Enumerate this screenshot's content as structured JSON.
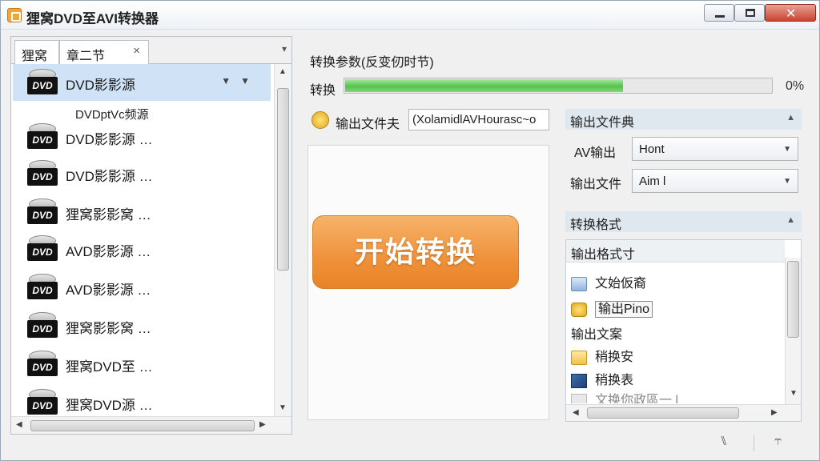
{
  "window": {
    "title": "狸窝DVD至AVI转换器",
    "close_glyph": "✕"
  },
  "tabs": [
    {
      "label": "狸窝"
    },
    {
      "label": "章二节",
      "close": "×"
    }
  ],
  "tab_menu_glyph": "▾",
  "list": {
    "items": [
      {
        "label": "DVD影影源",
        "icon": "DVD",
        "selected": true,
        "arrows": "▼▼"
      },
      {
        "label": "DVD影影源 …",
        "icon": "DVD"
      },
      {
        "label": "DVD影影源 …",
        "icon": "DVD"
      },
      {
        "label": "狸窝影影窝 …",
        "icon": "DVD"
      },
      {
        "label": "AVD影影源 …",
        "icon": "DVD"
      },
      {
        "label": "AVD影影源 …",
        "icon": "DVD"
      },
      {
        "label": "狸窝影影窝 …",
        "icon": "DVD"
      },
      {
        "label": "狸窝DVD至 …",
        "icon": "DVD"
      },
      {
        "label": "狸窝DVD源 …",
        "icon": "DVD"
      }
    ],
    "sub_item": "DVDptVc频源"
  },
  "conversion": {
    "params_label": "转换参数(反变仞时节)",
    "progress_label": "转换",
    "progress_fraction": 0.65,
    "progress_value": "0%"
  },
  "output": {
    "folder_label": "输出文件夫",
    "path_value": "(XolamidlAVHourasc~o"
  },
  "start_button": "开始转换",
  "right": {
    "section1_title": "输出文件典",
    "av_label": "AV输出",
    "av_value": "Hont",
    "file_label": "输出文件",
    "file_value": "Aim l",
    "section2_title": "转换格式",
    "format_list": {
      "header": "输出格式寸",
      "items": [
        {
          "label": "文始仮裔",
          "icon": "doc-icon"
        },
        {
          "label": "输出Pino",
          "icon": "shield-icon",
          "selected": true
        },
        {
          "label": "输出文案",
          "icon": "none"
        },
        {
          "label": "稍换安",
          "icon": "folder-icon"
        },
        {
          "label": "稍换表",
          "icon": "picture-icon"
        },
        {
          "label": "文换你政區一 l",
          "icon": "misc-icon"
        }
      ]
    }
  },
  "footer": {
    "icon1": "⑊",
    "icon2": "⥾"
  },
  "colors": {
    "accent_orange": "#ef913a",
    "progress_green": "#55c24c",
    "selection_blue": "#cfe2f6"
  }
}
